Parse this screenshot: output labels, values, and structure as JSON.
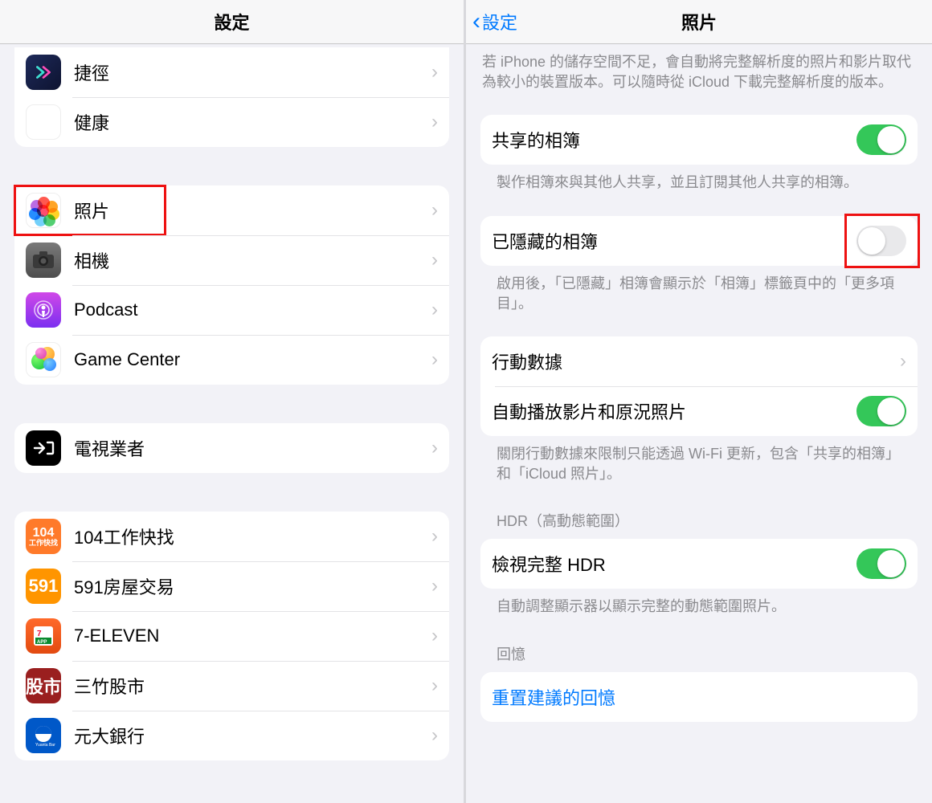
{
  "left": {
    "title": "設定",
    "groups": [
      {
        "items": [
          {
            "key": "shortcuts",
            "label": "捷徑",
            "iconClass": "ic-shortcuts"
          },
          {
            "key": "health",
            "label": "健康",
            "iconClass": "ic-health"
          }
        ]
      },
      {
        "items": [
          {
            "key": "photos",
            "label": "照片",
            "iconClass": "ic-photos",
            "highlight": true
          },
          {
            "key": "camera",
            "label": "相機",
            "iconClass": "ic-camera"
          },
          {
            "key": "podcast",
            "label": "Podcast",
            "iconClass": "ic-podcast"
          },
          {
            "key": "gamecenter",
            "label": "Game Center",
            "iconClass": "ic-gamecenter"
          }
        ]
      },
      {
        "items": [
          {
            "key": "tvprovider",
            "label": "電視業者",
            "iconClass": "ic-tv"
          }
        ]
      },
      {
        "items": [
          {
            "key": "app104",
            "label": "104工作快找",
            "iconClass": "ic-104"
          },
          {
            "key": "app591",
            "label": "591房屋交易",
            "iconClass": "ic-591"
          },
          {
            "key": "app711",
            "label": "7-ELEVEN",
            "iconClass": "ic-711"
          },
          {
            "key": "appstock",
            "label": "三竹股市",
            "iconClass": "ic-stock"
          },
          {
            "key": "appyuanta",
            "label": "元大銀行",
            "iconClass": "ic-yuanta"
          }
        ]
      }
    ]
  },
  "right": {
    "back": "設定",
    "title": "照片",
    "intro_note": "若 iPhone 的儲存空間不足，會自動將完整解析度的照片和影片取代為較小的裝置版本。可以隨時從 iCloud 下載完整解析度的版本。",
    "shared_albums": {
      "label": "共享的相簿",
      "on": true,
      "note": "製作相簿來與其他人共享，並且訂閱其他人共享的相簿。"
    },
    "hidden_album": {
      "label": "已隱藏的相簿",
      "on": false,
      "highlight": true,
      "note": "啟用後，「已隱藏」相簿會顯示於「相簿」標籤頁中的「更多項目」。"
    },
    "cellular": {
      "label": "行動數據"
    },
    "autoplay": {
      "label": "自動播放影片和原況照片",
      "on": true,
      "note": "關閉行動數據來限制只能透過 Wi-Fi 更新，包含「共享的相簿」和「iCloud 照片」。"
    },
    "hdr_header": "HDR（高動態範圍）",
    "hdr": {
      "label": "檢視完整 HDR",
      "on": true,
      "note": "自動調整顯示器以顯示完整的動態範圍照片。"
    },
    "memories_header": "回憶",
    "reset_memories": "重置建議的回憶"
  }
}
